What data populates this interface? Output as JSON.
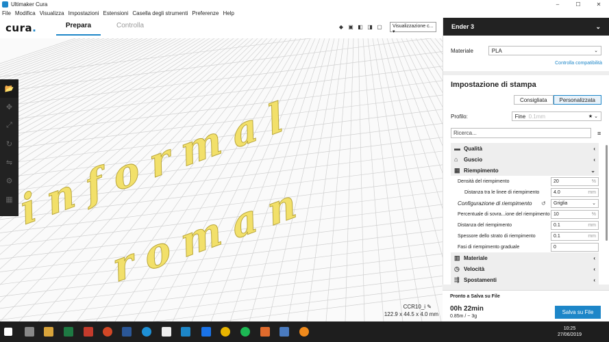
{
  "window": {
    "title": "Ultimaker Cura",
    "controls": [
      "–",
      "☐",
      "✕"
    ]
  },
  "menu": [
    "File",
    "Modifica",
    "Visualizza",
    "Impostazioni",
    "Estensioni",
    "Casella degli strumenti",
    "Preferenze",
    "Help"
  ],
  "header": {
    "logo": "cura",
    "stages": {
      "prepare": "Prepara",
      "monitor": "Controlla"
    },
    "view_select": "Visualizzazione c..."
  },
  "viewport": {
    "model_text_line1": "informal",
    "model_text_line2": "roman",
    "job_name": "CCR10_i",
    "dimensions": "122.9 x 44.5 x 4.0 mm"
  },
  "panel": {
    "printer": "Ender 3",
    "material_label": "Materiale",
    "material_value": "PLA",
    "compat_link": "Controlla compatibilità",
    "section_title": "Impostazione di stampa",
    "mode_recommended": "Consigliata",
    "mode_custom": "Personalizzata",
    "profile_label": "Profilo:",
    "profile_value": "Fine",
    "profile_hint": "0.1mm",
    "search_placeholder": "Ricerca...",
    "categories_top": [
      {
        "label": "Qualità",
        "icon": "quality-icon"
      },
      {
        "label": "Guscio",
        "icon": "shell-icon"
      },
      {
        "label": "Riempimento",
        "icon": "infill-icon"
      }
    ],
    "infill_settings": [
      {
        "label": "Densità del riempimento",
        "value": "20",
        "unit": "%"
      },
      {
        "label": "Distanza tra le linee di riempimento",
        "value": "4.0",
        "unit": "mm"
      },
      {
        "label": "Configurazione di riempimento",
        "value": "Griglia",
        "unit": ""
      },
      {
        "label": "Percentuale di sovra...ione del riempimento",
        "value": "10",
        "unit": "%"
      },
      {
        "label": "Distanza del riempimento",
        "value": "0.1",
        "unit": "mm"
      },
      {
        "label": "Spessore dello strato di riempimento",
        "value": "0.1",
        "unit": "mm"
      },
      {
        "label": "Fasi di riempimento graduale",
        "value": "0",
        "unit": ""
      }
    ],
    "categories_bottom": [
      {
        "label": "Materiale",
        "icon": "material-icon"
      },
      {
        "label": "Velocità",
        "icon": "speed-icon"
      },
      {
        "label": "Spostamenti",
        "icon": "travel-icon"
      }
    ]
  },
  "footer": {
    "status": "Pronto a Salva su File",
    "time": "00h 22min",
    "usage": "0.85m / ~ 3g",
    "save_button": "Salva su File"
  },
  "taskbar": {
    "time": "10:25",
    "date": "27/06/2019"
  },
  "colors": {
    "accent": "#1d86c8",
    "model": "#f5e67a",
    "dark": "#222222"
  }
}
